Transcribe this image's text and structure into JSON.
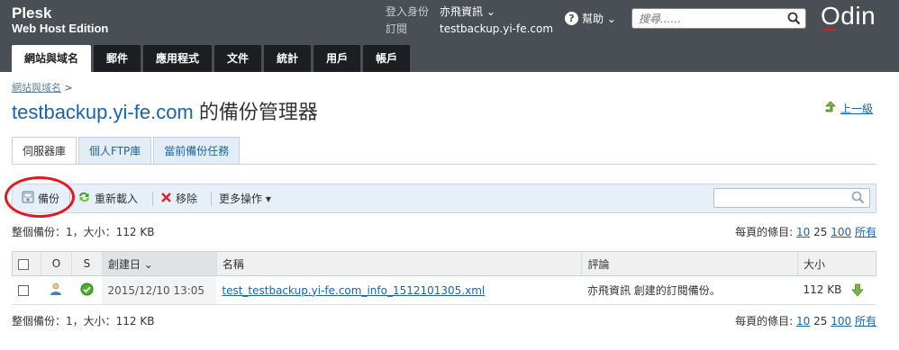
{
  "header": {
    "brand_line1": "Plesk",
    "brand_line2": "Web Host Edition",
    "login_as_label": "登入身份",
    "login_as_value": "亦飛資訊 ⌄",
    "subscription_label": "訂閱",
    "subscription_value": "testbackup.yi-fe.com",
    "help_label": "幫助 ⌄",
    "search_placeholder": "搜尋......",
    "logo_text": "Odin"
  },
  "nav_tabs": [
    {
      "label": "網站與域名",
      "active": true
    },
    {
      "label": "郵件"
    },
    {
      "label": "應用程式"
    },
    {
      "label": "文件"
    },
    {
      "label": "統計"
    },
    {
      "label": "用戶"
    },
    {
      "label": "帳戶"
    }
  ],
  "breadcrumb": {
    "link": "網站與域名",
    "separator": ">"
  },
  "page_title": {
    "domain": "testbackup.yi-fe.com",
    "suffix": " 的備份管理器"
  },
  "up_level": "上一級",
  "sub_tabs": [
    {
      "label": "伺服器庫",
      "active": true
    },
    {
      "label": "個人FTP庫"
    },
    {
      "label": "當前備份任務"
    }
  ],
  "toolbar": {
    "backup": "備份",
    "reload": "重新載入",
    "remove": "移除",
    "more": "更多操作 ▾"
  },
  "summary": "整個備份：1，大小：112 KB",
  "per_page": {
    "label": "每頁的條目:",
    "options": [
      "10",
      "25",
      "100",
      "所有"
    ]
  },
  "table": {
    "columns": [
      "O",
      "S",
      "創建日 ⌄",
      "名稱",
      "評論",
      "大小"
    ],
    "rows": [
      {
        "created": "2015/12/10 13:05",
        "name": "test_testbackup.yi-fe.com_info_1512101305.xml",
        "comment": "亦飛資訊 創建的訂閱備份。",
        "size": "112 KB"
      }
    ]
  },
  "colors": {
    "header_bg": "#4a4e55",
    "link_blue": "#1c63a7",
    "highlight_red": "#e0191e",
    "status_green": "#4caf2a"
  }
}
